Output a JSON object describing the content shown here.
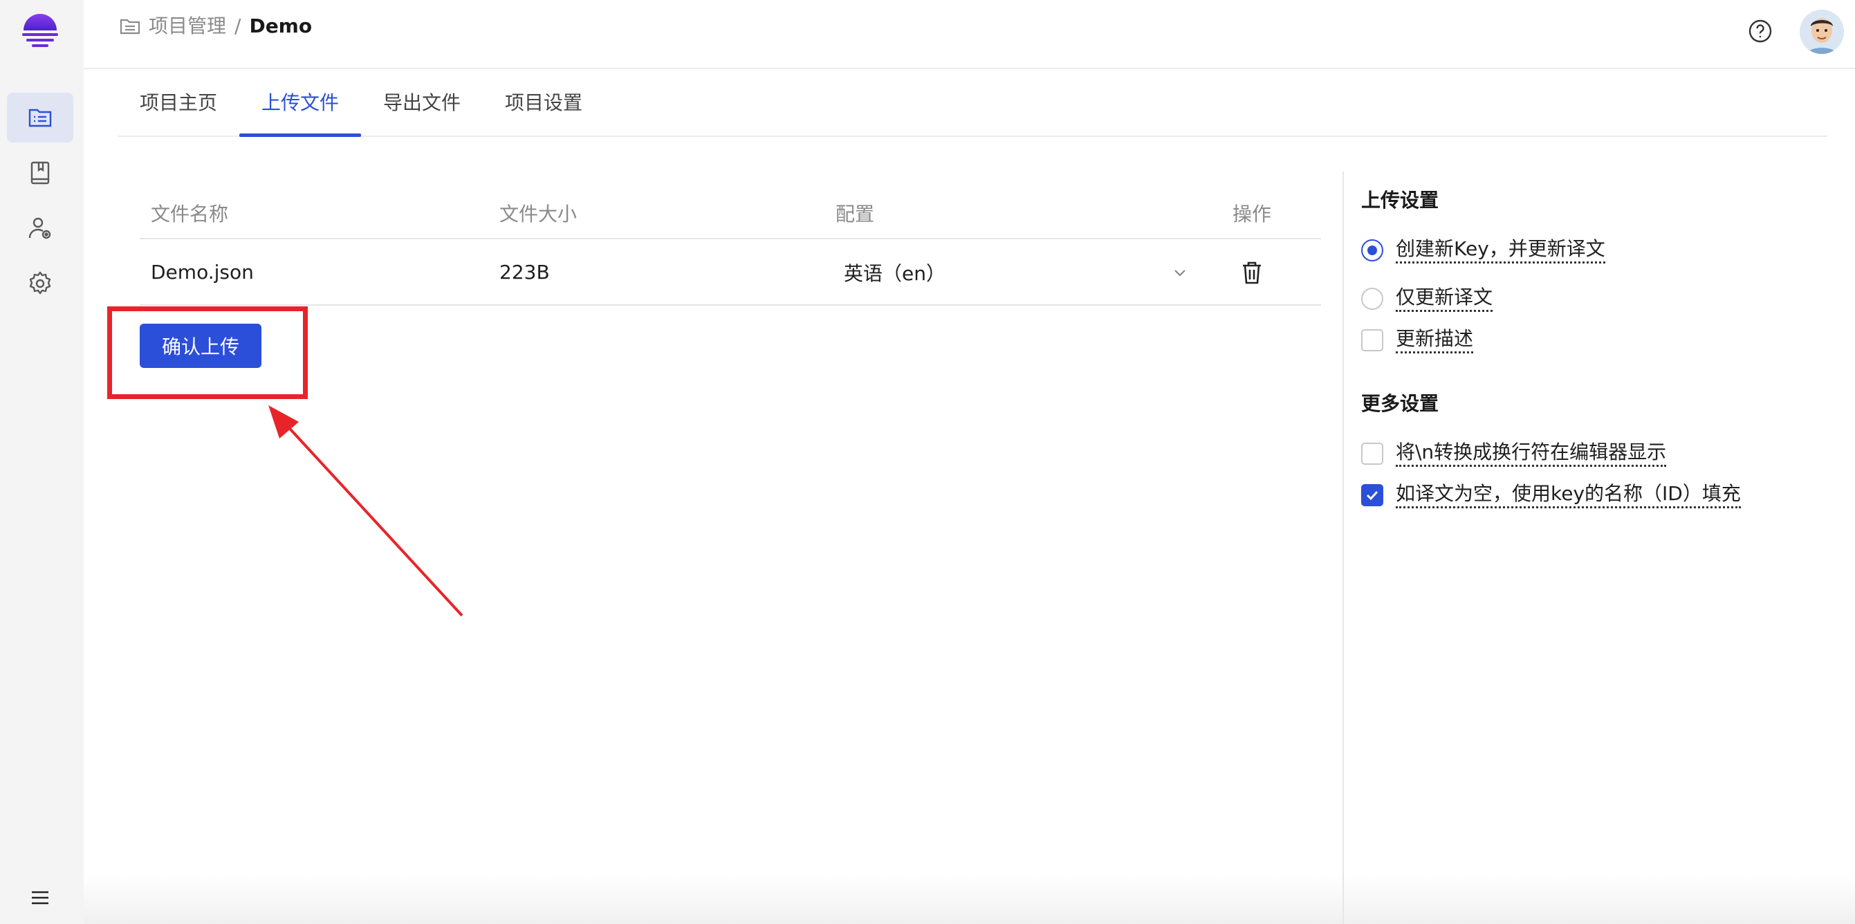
{
  "breadcrumb": {
    "parent": "项目管理",
    "separator": "/",
    "current": "Demo"
  },
  "tabs": [
    {
      "label": "项目主页"
    },
    {
      "label": "上传文件"
    },
    {
      "label": "导出文件"
    },
    {
      "label": "项目设置"
    }
  ],
  "active_tab": "上传文件",
  "table": {
    "headers": {
      "name": "文件名称",
      "size": "文件大小",
      "config": "配置",
      "action": "操作"
    },
    "rows": [
      {
        "name": "Demo.json",
        "size": "223B",
        "config": "英语（en）"
      }
    ]
  },
  "confirm_button": "确认上传",
  "upload_settings": {
    "title": "上传设置",
    "options": [
      {
        "label": "创建新Key，并更新译文",
        "type": "radio",
        "checked": true
      },
      {
        "label": "仅更新译文",
        "type": "radio",
        "checked": false
      },
      {
        "label": "更新描述",
        "type": "checkbox",
        "checked": false
      }
    ]
  },
  "more_settings": {
    "title": "更多设置",
    "options": [
      {
        "label": "将\\n转换成换行符在编辑器显示",
        "type": "checkbox",
        "checked": false
      },
      {
        "label": "如译文为空，使用key的名称（ID）填充",
        "type": "checkbox",
        "checked": true
      }
    ]
  },
  "colors": {
    "accent": "#2b4fd8",
    "annotation": "#e8242a",
    "logo": "#6a2bd8"
  },
  "sidebar_icons": [
    "project-list-icon",
    "book-icon",
    "user-settings-icon",
    "gear-icon",
    "menu-icon"
  ]
}
